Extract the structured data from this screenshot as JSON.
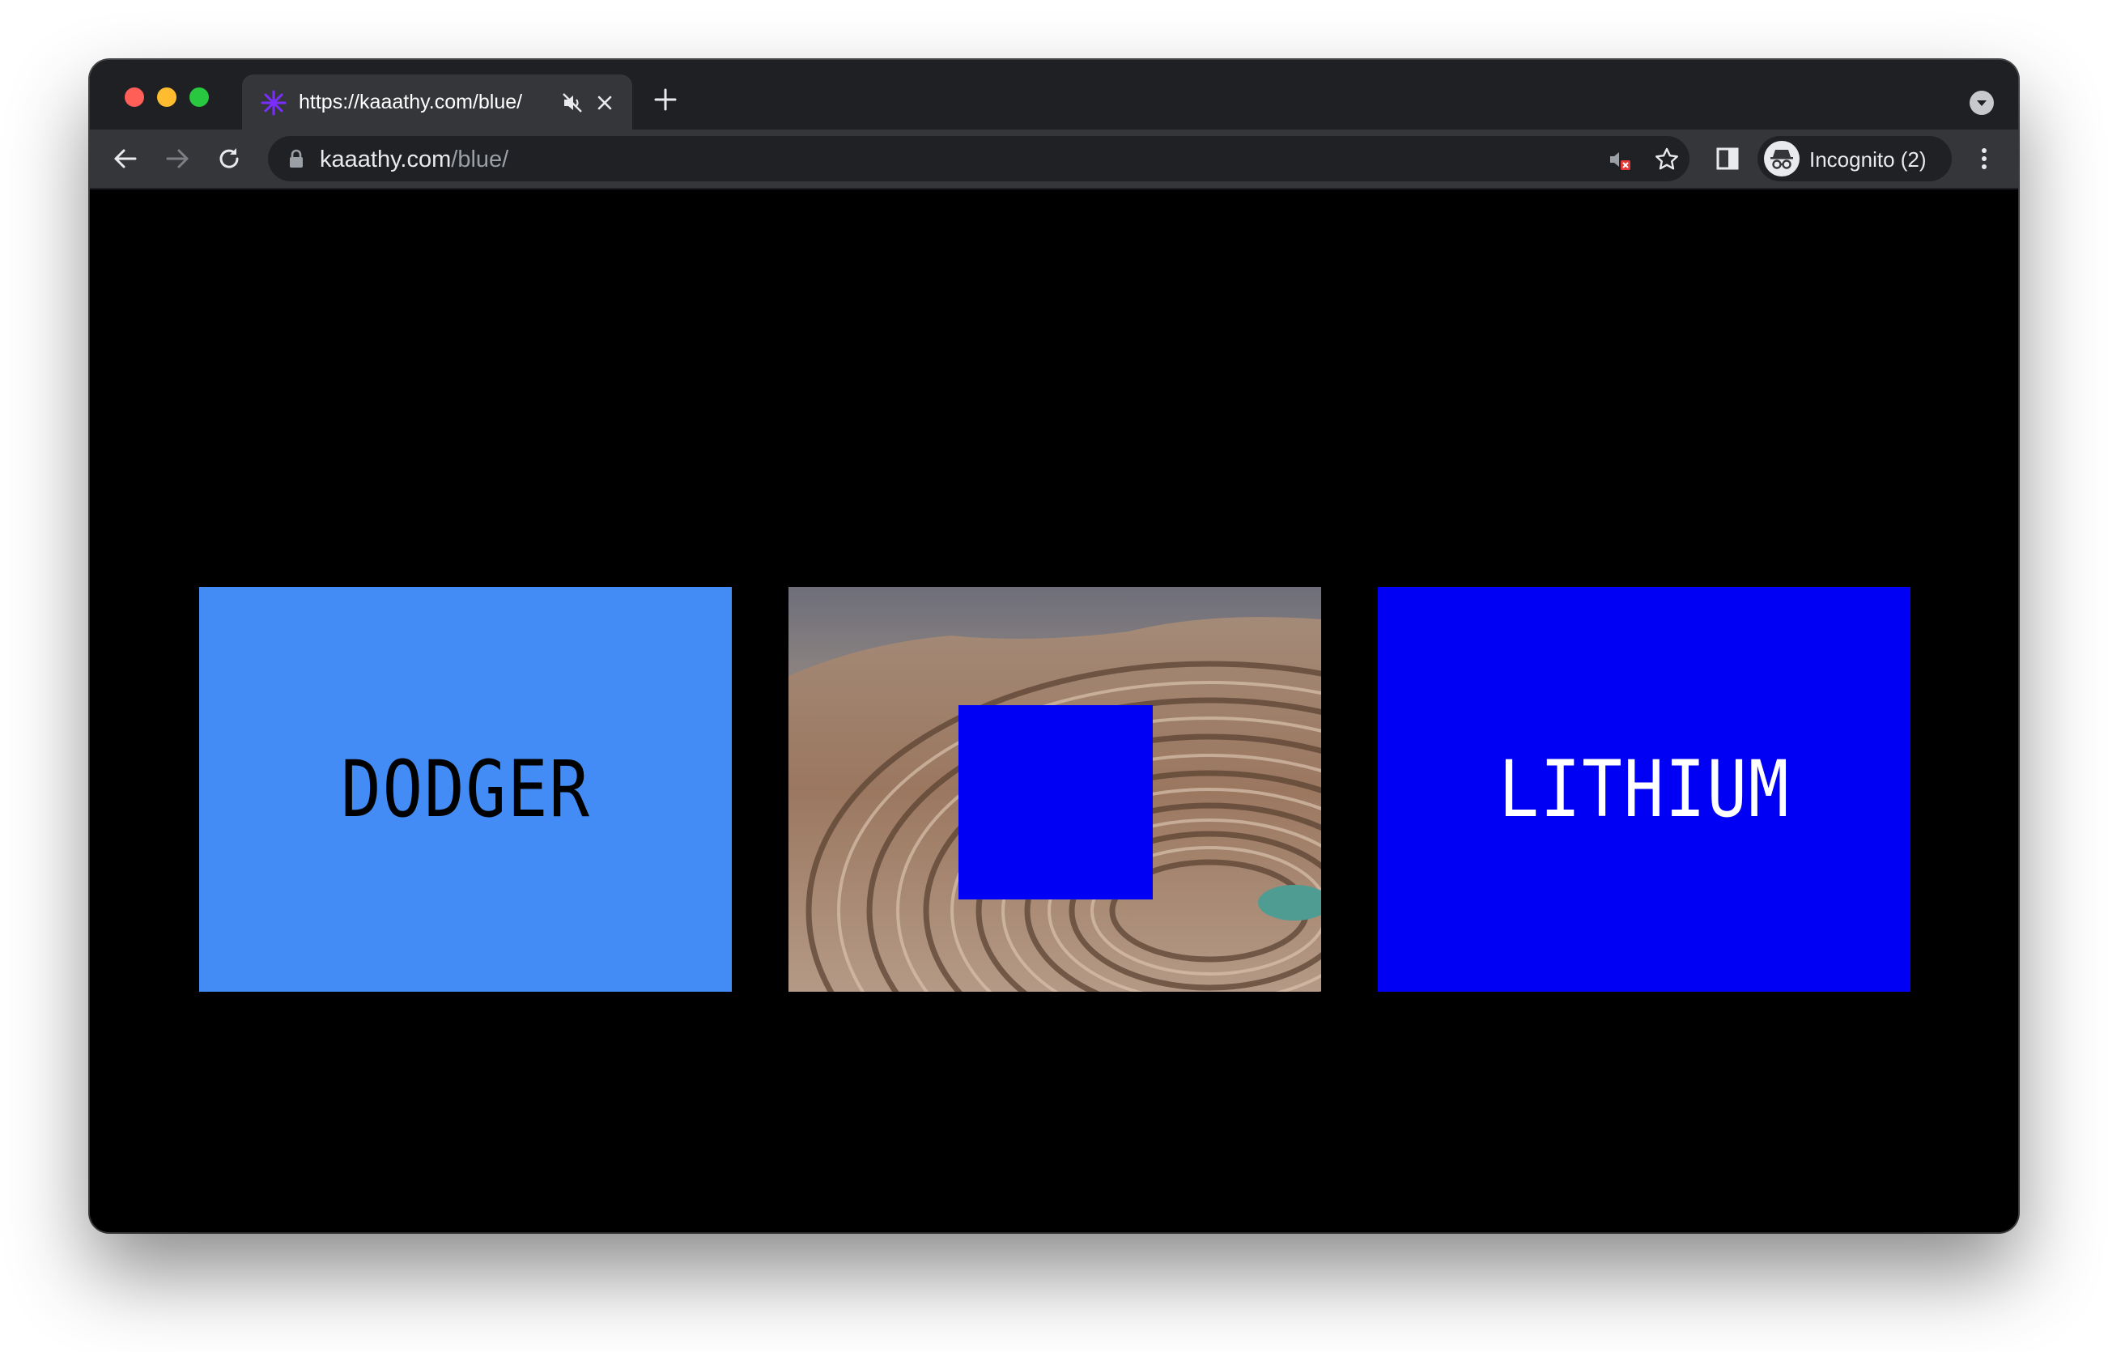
{
  "browser": {
    "tab": {
      "title": "https://kaaathy.com/blue/",
      "favicon": "asterisk-favicon-icon",
      "favicon_color": "#7b2cff"
    },
    "address_bar": {
      "host": "kaaathy.com",
      "path": "/blue/"
    },
    "profile": {
      "label": "Incognito (2)",
      "icon": "incognito-icon"
    },
    "icons": {
      "back": "back-arrow-icon",
      "forward": "forward-arrow-icon",
      "reload": "reload-icon",
      "lock": "lock-icon",
      "site_sound_blocked": "sound-blocked-icon",
      "bookmark": "star-icon",
      "side_panel": "side-panel-icon",
      "menu": "kebab-menu-icon",
      "new_tab": "plus-icon",
      "tab_close": "close-icon",
      "tab_mute": "muted-speaker-icon",
      "tab_search": "chevron-down-icon"
    }
  },
  "page": {
    "cards": [
      {
        "label": "DODGER",
        "background": "#438cf5",
        "text_color": "#000000"
      },
      {
        "label": "",
        "image": "open-pit-mine-photo",
        "overlay_color": "#0000f5"
      },
      {
        "label": "LITHIUM",
        "background": "#0000f5",
        "text_color": "#ffffff"
      }
    ]
  }
}
